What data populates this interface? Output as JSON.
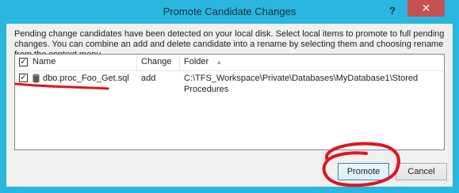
{
  "window": {
    "title": "Promote Candidate Changes",
    "help_label": "?",
    "close_label": "✕"
  },
  "description": "Pending change candidates have been detected on your local disk. Select local items to promote to full pending changes. You can combine an add and delete candidate into a rename by selecting them and choosing rename from the context menu.",
  "list": {
    "columns": [
      "Name",
      "Change",
      "Folder"
    ],
    "sort_indicator": "▲",
    "header_checked": true,
    "rows": [
      {
        "checked": true,
        "icon": "database-file-icon",
        "name": "dbo.proc_Foo_Get.sql",
        "change": "add",
        "folder": "C:\\TFS_Workspace\\Private\\Databases\\MyDatabase1\\Stored Procedures"
      }
    ]
  },
  "buttons": {
    "promote": "Promote",
    "cancel": "Cancel"
  },
  "colors": {
    "title_bar": "#29b7df",
    "close_button": "#c75050",
    "annotation": "#e0141e"
  }
}
